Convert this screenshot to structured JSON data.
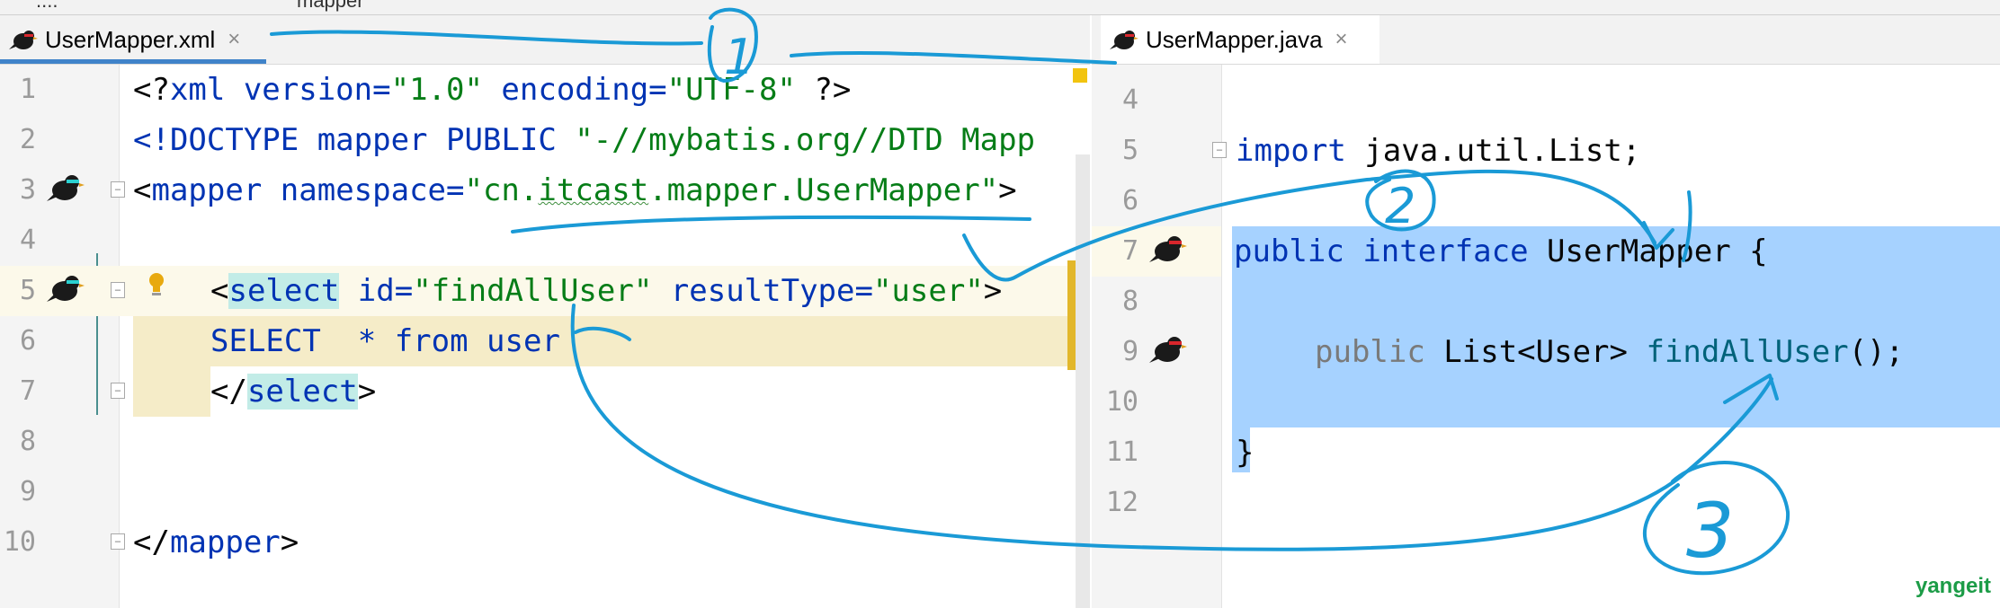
{
  "top_strip": {
    "fragments": [
      "....",
      "mapper",
      "....mapper"
    ]
  },
  "left_tab": {
    "title": "UserMapper.xml",
    "close": "×"
  },
  "right_tab": {
    "title": "UserMapper.java",
    "close": "×"
  },
  "xml_editor": {
    "line_numbers": [
      "1",
      "2",
      "3",
      "4",
      "5",
      "6",
      "7",
      "8",
      "9",
      "10"
    ],
    "line1": {
      "a": "<?",
      "b": "xml version=",
      "c": "\"1.0\"",
      "d": " encoding=",
      "e": "\"UTF-8\"",
      "f": " ?>"
    },
    "line2": {
      "a": "<!DOCTYPE mapper PUBLIC ",
      "b": "\"-//mybatis.org//DTD Mapp"
    },
    "line3": {
      "a": "<",
      "b": "mapper",
      "c": " namespace=",
      "d": "\"cn.",
      "e": "itcast",
      "f": ".mapper.UserMapper\"",
      "g": ">"
    },
    "line5": {
      "a": "<",
      "b": "select",
      "c": " id=",
      "d": "\"findAllUser\"",
      "e": " resultType=",
      "f": "\"user\"",
      "g": ">"
    },
    "line6": {
      "a": "SELECT  * from user"
    },
    "line7": {
      "a": "</",
      "b": "select",
      "c": ">"
    },
    "line10": {
      "a": "</",
      "b": "mapper",
      "c": ">"
    }
  },
  "java_editor": {
    "line_numbers": [
      "4",
      "5",
      "6",
      "7",
      "8",
      "9",
      "10",
      "11",
      "12"
    ],
    "line5": {
      "a": "import",
      "b": " java.util.List;"
    },
    "line7": {
      "a": "public",
      "b": " ",
      "c": "interface",
      "d": " UserMapper {"
    },
    "line9": {
      "a": "public",
      "b": " List<User> ",
      "c": "findAllUser",
      "d": "();"
    },
    "line11": {
      "a": "}"
    }
  },
  "annotations": {
    "one": "1",
    "two": "2",
    "three": "3"
  },
  "watermark": "yangeit",
  "colors": {
    "keyword": "#0033b3",
    "string": "#067d17",
    "method": "#00627a",
    "selection": "#a6d2ff",
    "highlight": "#f5ecc8",
    "ink": "#1a9ad6",
    "tab_underline": "#4083c9"
  }
}
